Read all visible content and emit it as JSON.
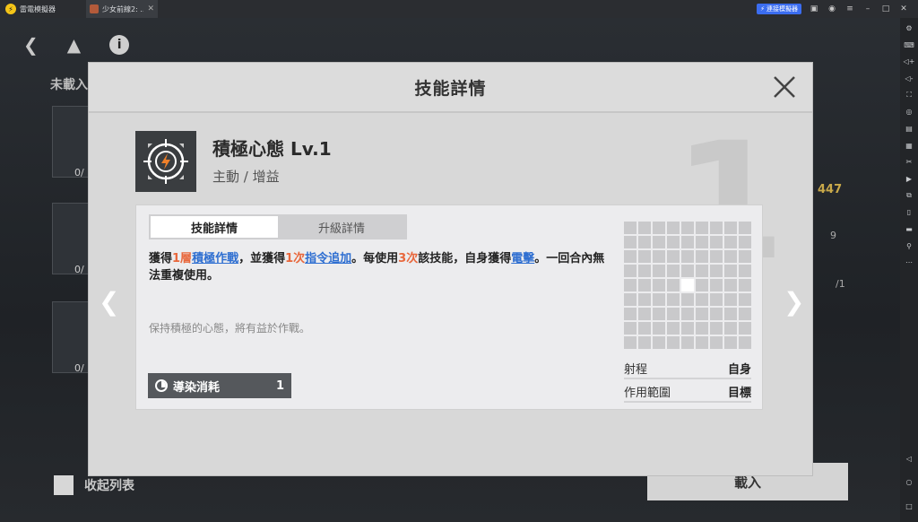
{
  "titlebar": {
    "app_name": "雷電模擬器",
    "tab_label": "少女前線2: ...",
    "connect_label": "連接模擬器"
  },
  "background": {
    "unloaded_label": "未載入",
    "card_counts": [
      "0/",
      "0/",
      "0/"
    ],
    "stat_value": "447",
    "stat_value2": "9",
    "stat_value3": "/1",
    "collapse_label": "收起列表",
    "load_button": "載入"
  },
  "dialog": {
    "title": "技能詳情",
    "big_level": "1",
    "skill": {
      "name": "積極心態 Lv.1",
      "type": "主動 / 增益"
    },
    "tabs": [
      "技能詳情",
      "升級詳情"
    ],
    "active_tab": 0,
    "description": {
      "p1": "獲得",
      "n1": "1層",
      "l1": "積極作戰",
      "p2": "，並獲得",
      "n2": "1次",
      "l2": "指令追加",
      "p3": "。每使用",
      "n3": "3次",
      "p4": "該技能，自身獲得",
      "l3": "電擊",
      "p5": "。一回合內無法重複使用。"
    },
    "flavor": "保持積極的心態，將有益於作戰。",
    "cost": {
      "label": "導染消耗",
      "value": "1"
    },
    "range": [
      {
        "label": "射程",
        "value": "自身"
      },
      {
        "label": "作用範圍",
        "value": "目標"
      }
    ]
  },
  "colors": {
    "highlight_number": "#e8673c",
    "highlight_link": "#2f6fd1",
    "emulator_accent": "#3b6df0"
  }
}
